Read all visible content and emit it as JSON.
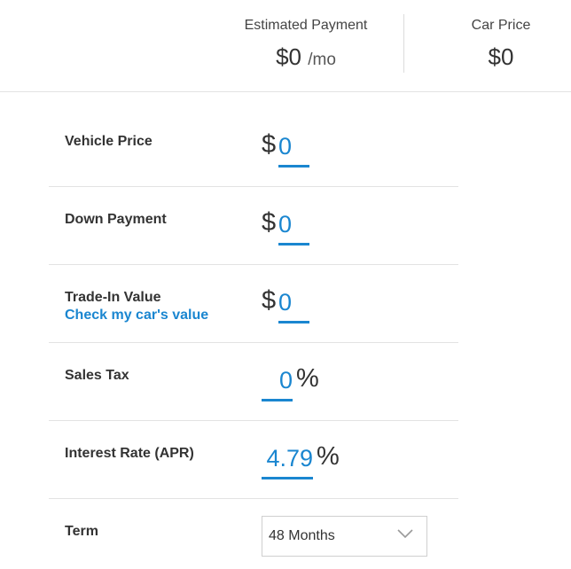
{
  "summary": {
    "payment_label": "Estimated Payment",
    "payment_value": "$0",
    "payment_unit": "/mo",
    "price_label": "Car Price",
    "price_value": "$0"
  },
  "form": {
    "currency_symbol": "$",
    "percent_symbol": "%",
    "vehicle_price": {
      "label": "Vehicle Price",
      "value": "0"
    },
    "down_payment": {
      "label": "Down Payment",
      "value": "0"
    },
    "trade_in": {
      "label": "Trade-In Value",
      "link": "Check my car's value",
      "value": "0"
    },
    "sales_tax": {
      "label": "Sales Tax",
      "value": "0"
    },
    "interest_rate": {
      "label": "Interest Rate (APR)",
      "value": "4.79"
    },
    "term": {
      "label": "Term",
      "selected": "48 Months"
    }
  },
  "colors": {
    "accent": "#1a86d0",
    "text": "#333333",
    "divider": "#e3e3e3"
  },
  "icons": {
    "term_dropdown": "chevron-down-icon"
  }
}
